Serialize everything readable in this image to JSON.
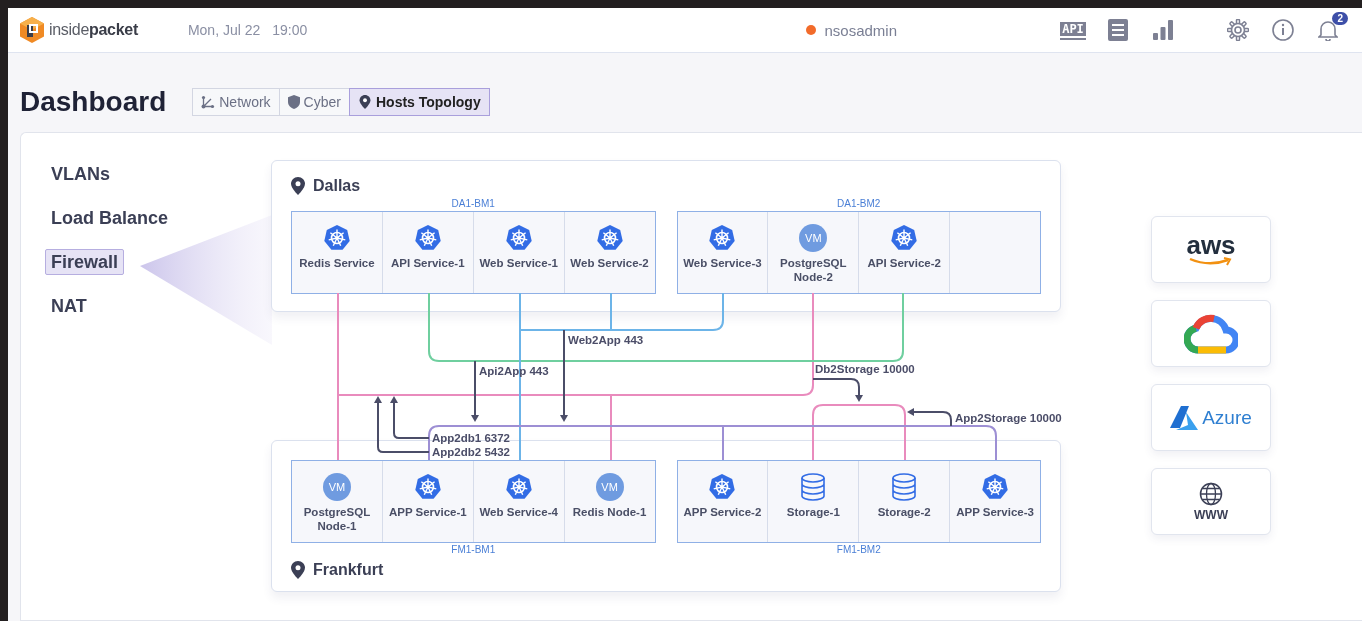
{
  "header": {
    "logo": "inside**packet**",
    "date": "Mon, Jul 22",
    "time": "19:00",
    "user": {
      "name": "nsosadmin",
      "online": true
    },
    "tools": [
      {
        "kind": "api",
        "label": "API"
      },
      {
        "kind": "list"
      },
      {
        "kind": "bars"
      },
      {
        "kind": "settings"
      },
      {
        "kind": "info"
      },
      {
        "kind": "bell",
        "badge": "2"
      }
    ]
  },
  "title": "Dashboard",
  "tabs": [
    {
      "label": "Network",
      "kind": "network",
      "selected": false
    },
    {
      "label": "Cyber",
      "kind": "shield",
      "selected": false
    },
    {
      "label": "Hosts Topology",
      "kind": "pin",
      "selected": true
    }
  ],
  "menu": [
    {
      "label": "VLANs",
      "selected": false
    },
    {
      "label": "Load Balance",
      "selected": false
    },
    {
      "label": "Firewall",
      "selected": true
    },
    {
      "label": "NAT",
      "selected": false
    }
  ],
  "topology": {
    "sites": [
      {
        "name": "Dallas",
        "kind": "upper",
        "hosts": [
          {
            "name": "DA1-BM1",
            "nodes": [
              {
                "kind": "k8s",
                "name": "Redis Service"
              },
              {
                "kind": "k8s",
                "name": "API Service-1"
              },
              {
                "kind": "k8s",
                "name": "Web Service-1"
              },
              {
                "kind": "k8s",
                "name": "Web Service-2"
              }
            ]
          },
          {
            "name": "DA1-BM2",
            "nodes": [
              {
                "kind": "k8s",
                "name": "Web Service-3"
              },
              {
                "kind": "vm",
                "icon_text": "VM",
                "name": "PostgreSQL Node-2"
              },
              {
                "kind": "k8s",
                "name": "API Service-2"
              },
              {
                "kind": "empty"
              }
            ]
          }
        ]
      },
      {
        "name": "Frankfurt",
        "kind": "lower",
        "hosts": [
          {
            "name": "FM1-BM1",
            "nodes": [
              {
                "kind": "vm",
                "icon_text": "VM",
                "name": "PostgreSQL Node-1"
              },
              {
                "kind": "k8s",
                "name": "APP Service-1"
              },
              {
                "kind": "k8s",
                "name": "Web Service-4"
              },
              {
                "kind": "vm",
                "icon_text": "VM",
                "name": "Redis Node-1"
              }
            ]
          },
          {
            "name": "FM1-BM2",
            "nodes": [
              {
                "kind": "k8s",
                "name": "APP Service-2"
              },
              {
                "kind": "storage",
                "name": "Storage-1"
              },
              {
                "kind": "storage",
                "name": "Storage-2"
              },
              {
                "kind": "k8s",
                "name": "APP Service-3"
              }
            ]
          }
        ]
      }
    ],
    "links": [
      {
        "color": "#e98bbd"
      },
      {
        "color": "#6fcf9f"
      },
      {
        "color": "#6cb4e8"
      },
      {
        "color": "#9d8fd4"
      }
    ],
    "flows": [
      {
        "label": "Web2App 443"
      },
      {
        "label": "Api2App 443"
      },
      {
        "label": "Db2Storage 10000"
      },
      {
        "label": "App2Storage 10000"
      },
      {
        "label": "App2db1 6372"
      },
      {
        "label": "App2db2 5432"
      }
    ]
  },
  "clouds": [
    {
      "kind": "aws",
      "label": "aws"
    },
    {
      "kind": "gcp"
    },
    {
      "kind": "azure",
      "label": "Azure"
    },
    {
      "kind": "www",
      "label": "WWW"
    }
  ]
}
